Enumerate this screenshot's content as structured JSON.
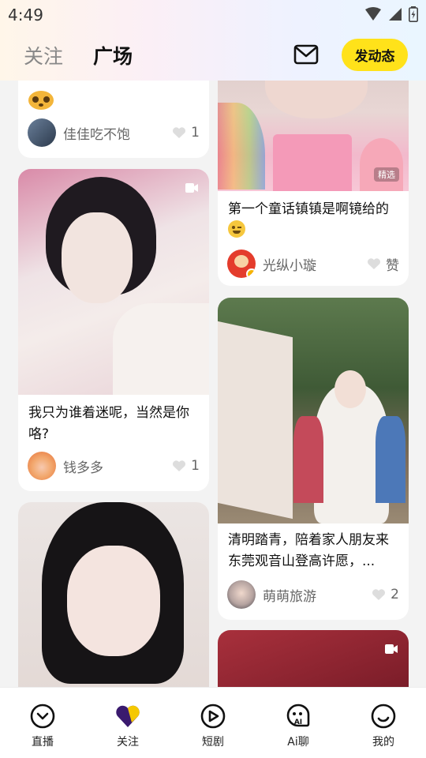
{
  "status": {
    "time": "4:49"
  },
  "header": {
    "tabs": [
      {
        "label": "关注"
      },
      {
        "label": "广场"
      }
    ],
    "post_label": "发动态"
  },
  "feed": {
    "left": [
      {
        "caption": "",
        "author": "佳佳吃不饱",
        "likes": "1"
      },
      {
        "caption": "我只为谁着迷呢，当然是你咯?",
        "author": "钱多多",
        "likes": "1"
      },
      {
        "caption": "",
        "author": "",
        "likes": ""
      }
    ],
    "right": [
      {
        "caption": "第一个童话镇镇是啊镜给的",
        "author": "光纵小璇",
        "likes": "赞",
        "badge": "精选"
      },
      {
        "caption": "清明踏青，陪着家人朋友来东莞观音山登高许愿，...",
        "author": "萌萌旅游",
        "likes": "2"
      },
      {
        "caption": "",
        "author": "",
        "likes": ""
      }
    ]
  },
  "bottom_nav": [
    {
      "label": "直播"
    },
    {
      "label": "关注"
    },
    {
      "label": "短剧"
    },
    {
      "label": "Ai聊"
    },
    {
      "label": "我的"
    }
  ],
  "colors": {
    "accent": "#ffe21a",
    "nav_active": "#3a1a6e"
  }
}
